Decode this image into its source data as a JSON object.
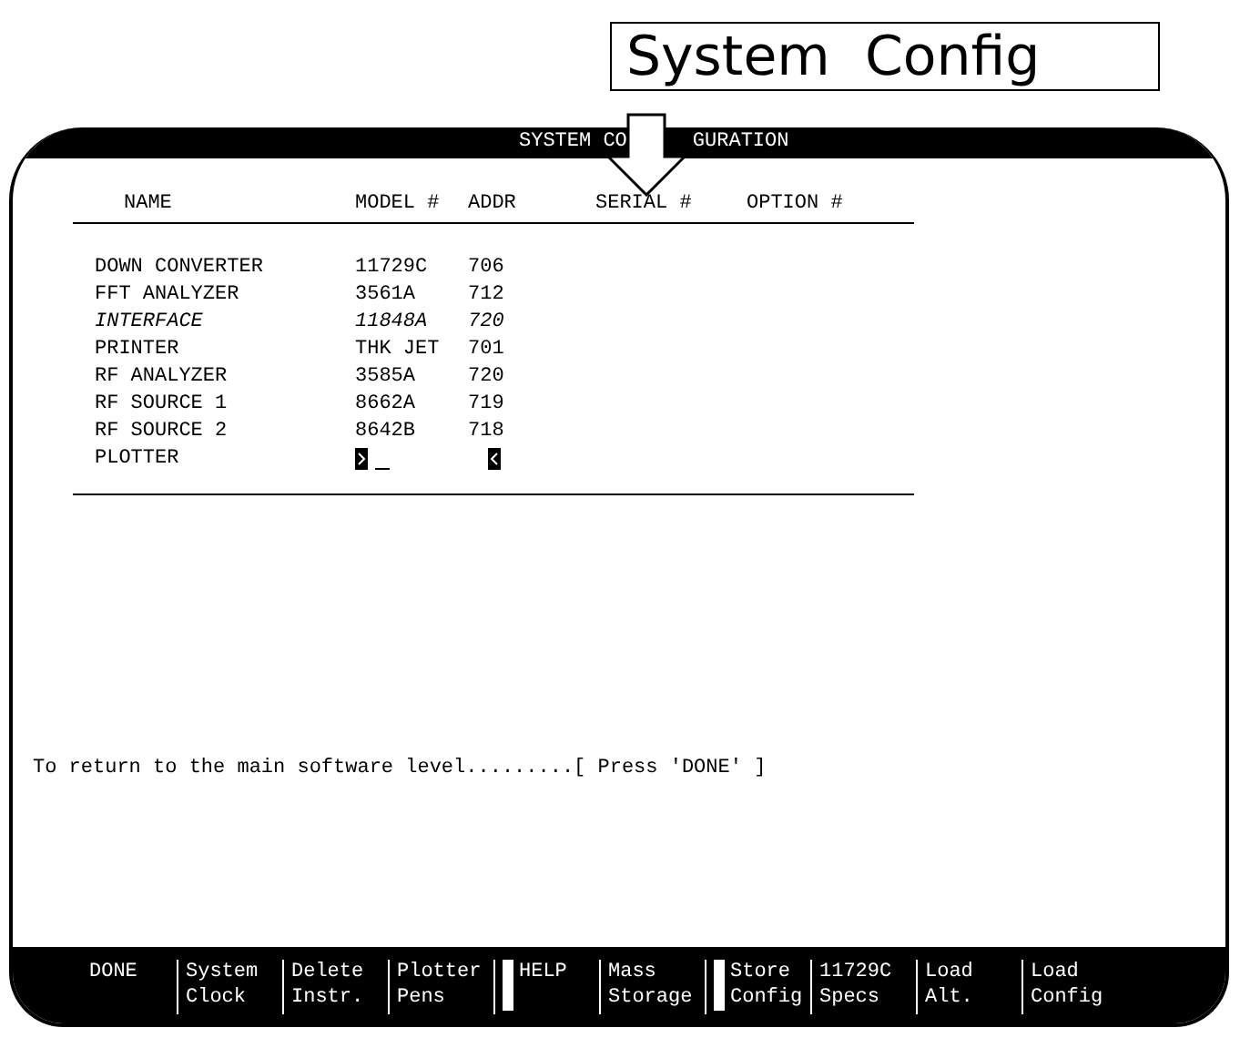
{
  "callout": {
    "label": "System  Config"
  },
  "screen": {
    "title_left": "SYSTEM CO",
    "title_right": "GURATION"
  },
  "table": {
    "columns": [
      "NAME",
      "MODEL #",
      "ADDR",
      "SERIAL #",
      "OPTION #"
    ],
    "rows": [
      {
        "name": "DOWN CONVERTER",
        "model": "11729C",
        "addr": "706",
        "emphasized": false
      },
      {
        "name": "FFT ANALYZER",
        "model": "3561A",
        "addr": "712",
        "emphasized": false
      },
      {
        "name": "INTERFACE",
        "model": "11848A",
        "addr": "720",
        "emphasized": true
      },
      {
        "name": "PRINTER",
        "model": "THK JET",
        "addr": "701",
        "emphasized": false
      },
      {
        "name": "RF ANALYZER",
        "model": "3585A",
        "addr": "720",
        "emphasized": false
      },
      {
        "name": "RF SOURCE 1",
        "model": "8662A",
        "addr": "719",
        "emphasized": false
      },
      {
        "name": "RF SOURCE 2",
        "model": "8642B",
        "addr": "718",
        "emphasized": false
      }
    ],
    "entry_row": {
      "name": "PLOTTER"
    }
  },
  "message": "To return to the main software level.........[ Press 'DONE' ]",
  "softkeys": [
    {
      "lines": [
        "DONE"
      ],
      "marked": false
    },
    {
      "lines": [
        "System",
        "Clock"
      ],
      "marked": false
    },
    {
      "lines": [
        "Delete",
        "Instr."
      ],
      "marked": false
    },
    {
      "lines": [
        "Plotter",
        "Pens"
      ],
      "marked": false
    },
    {
      "lines": [
        "HELP"
      ],
      "marked": true
    },
    {
      "lines": [
        "Mass",
        "Storage"
      ],
      "marked": false
    },
    {
      "lines": [
        "Store",
        "Config"
      ],
      "marked": true
    },
    {
      "lines": [
        "11729C",
        "Specs"
      ],
      "marked": false
    },
    {
      "lines": [
        "Load",
        "Alt."
      ],
      "marked": false
    },
    {
      "lines": [
        "Load",
        "Config"
      ],
      "marked": false
    }
  ]
}
